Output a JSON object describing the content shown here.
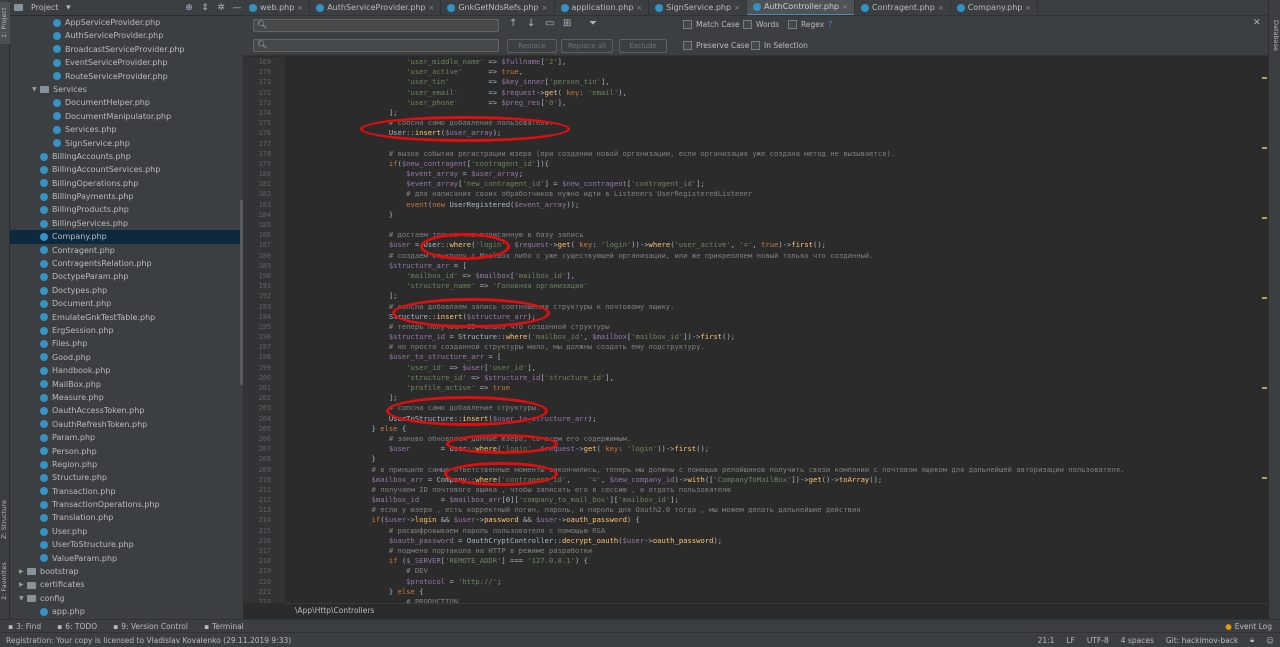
{
  "left_strip": {
    "project_label": "1: Project",
    "structure_label": "Z: Structure",
    "favorites_label": "2: Favorites"
  },
  "right_strip": {
    "database_label": "Database"
  },
  "project_panel": {
    "title": "Project",
    "items": [
      {
        "label": "AppServiceProvider.php",
        "kind": "file",
        "indent": 3
      },
      {
        "label": "AuthServiceProvider.php",
        "kind": "file",
        "indent": 3
      },
      {
        "label": "BroadcastServiceProvider.php",
        "kind": "file",
        "indent": 3
      },
      {
        "label": "EventServiceProvider.php",
        "kind": "file",
        "indent": 3
      },
      {
        "label": "RouteServiceProvider.php",
        "kind": "file",
        "indent": 3
      },
      {
        "label": "Services",
        "kind": "folder-open",
        "indent": 2
      },
      {
        "label": "DocumentHelper.php",
        "kind": "file",
        "indent": 3
      },
      {
        "label": "DocumentManipulator.php",
        "kind": "file",
        "indent": 3
      },
      {
        "label": "Services.php",
        "kind": "file",
        "indent": 3
      },
      {
        "label": "SignService.php",
        "kind": "file",
        "indent": 3
      },
      {
        "label": "BillingAccounts.php",
        "kind": "file",
        "indent": 2
      },
      {
        "label": "BillingAccountServices.php",
        "kind": "file",
        "indent": 2
      },
      {
        "label": "BillingOperations.php",
        "kind": "file",
        "indent": 2
      },
      {
        "label": "BillingPayments.php",
        "kind": "file",
        "indent": 2
      },
      {
        "label": "BillingProducts.php",
        "kind": "file",
        "indent": 2
      },
      {
        "label": "BillingServices.php",
        "kind": "file",
        "indent": 2
      },
      {
        "label": "Company.php",
        "kind": "file",
        "indent": 2,
        "selected": true
      },
      {
        "label": "Contragent.php",
        "kind": "file",
        "indent": 2
      },
      {
        "label": "ContragentsRelation.php",
        "kind": "file",
        "indent": 2
      },
      {
        "label": "DoctypeParam.php",
        "kind": "file",
        "indent": 2
      },
      {
        "label": "Doctypes.php",
        "kind": "file",
        "indent": 2
      },
      {
        "label": "Document.php",
        "kind": "file",
        "indent": 2
      },
      {
        "label": "EmulateGnkTestTable.php",
        "kind": "file",
        "indent": 2
      },
      {
        "label": "ErgSession.php",
        "kind": "file",
        "indent": 2
      },
      {
        "label": "Files.php",
        "kind": "file",
        "indent": 2
      },
      {
        "label": "Good.php",
        "kind": "file",
        "indent": 2
      },
      {
        "label": "Handbook.php",
        "kind": "file",
        "indent": 2
      },
      {
        "label": "MailBox.php",
        "kind": "file",
        "indent": 2
      },
      {
        "label": "Measure.php",
        "kind": "file",
        "indent": 2
      },
      {
        "label": "OauthAccessToken.php",
        "kind": "file",
        "indent": 2
      },
      {
        "label": "OauthRefreshToken.php",
        "kind": "file",
        "indent": 2
      },
      {
        "label": "Param.php",
        "kind": "file",
        "indent": 2
      },
      {
        "label": "Person.php",
        "kind": "file",
        "indent": 2
      },
      {
        "label": "Region.php",
        "kind": "file",
        "indent": 2
      },
      {
        "label": "Structure.php",
        "kind": "file",
        "indent": 2
      },
      {
        "label": "Transaction.php",
        "kind": "file",
        "indent": 2
      },
      {
        "label": "TransactionOperations.php",
        "kind": "file",
        "indent": 2
      },
      {
        "label": "Translation.php",
        "kind": "file",
        "indent": 2
      },
      {
        "label": "User.php",
        "kind": "file",
        "indent": 2
      },
      {
        "label": "UserToStructure.php",
        "kind": "file",
        "indent": 2
      },
      {
        "label": "ValueParam.php",
        "kind": "file",
        "indent": 2
      },
      {
        "label": "bootstrap",
        "kind": "folder",
        "indent": 1
      },
      {
        "label": "certificates",
        "kind": "folder",
        "indent": 1
      },
      {
        "label": "config",
        "kind": "folder-open",
        "indent": 1
      },
      {
        "label": "app.php",
        "kind": "file",
        "indent": 2
      }
    ]
  },
  "tabs": [
    {
      "label": "web.php"
    },
    {
      "label": "AuthServiceProvider.php"
    },
    {
      "label": "GnkGetNdsRefs.php"
    },
    {
      "label": "application.php"
    },
    {
      "label": "SignService.php"
    },
    {
      "label": "AuthController.php",
      "active": true
    },
    {
      "label": "Contragent.php"
    },
    {
      "label": "Company.php"
    }
  ],
  "search": {
    "find_placeholder": "",
    "replace_label": "Replace",
    "replace_all_label": "Replace all",
    "exclude_label": "Exclude",
    "match_case_label": "Match Case",
    "words_label": "Words",
    "regex_label": "Regex",
    "regex_help": "?",
    "preserve_case_label": "Preserve Case",
    "in_selection_label": "In Selection"
  },
  "editor": {
    "first_line": 169,
    "lines": [
      "                            'user_middle_name' => $fullname['2'],",
      "                            'user_active'      => true,",
      "                            'user_tin'         => $key_inner['person_tin'],",
      "                            'user_email'       => $request->get( key: 'email'),",
      "                            'user_phone'       => $preg_res['0'],",
      "                        ];",
      "                        # сопсна само добавление пользователя.",
      "                        User::insert($user_array);",
      "",
      "                        # вызов события регистрации юзера (при создании новой организации, если организация уже создана метод не вызывается).",
      "                        if($new_contragent['contragent_id']){",
      "                            $event_array = $user_array;",
      "                            $event_array['new_contragent_id'] = $new_contragent['contragent_id'];",
      "                            # для написания своих обработчиков нужно идти в Listeners UserRegisteredListener",
      "                            event(new UserRegistered($event_array));",
      "                        }",
      "",
      "                        # достаем только что записанную в базу запись",
      "                        $user = User::where('login', $request->get( key: 'login'))->where('user_active', '=', true)->first();",
      "                        # создаем стукруру с MailBox либо с уже существующей организации, или же прикрепляем новый только что созданный.",
      "                        $structure_arr = [",
      "                            'mailbox_id' => $mailbox['mailbox_id'],",
      "                            'structure_name' => 'Головная организация'",
      "                        ];",
      "                        # сопсна добавляем запись соотношения структуры к почтовому ящику.",
      "                        Structure::insert($structure_arr);",
      "                        # теперь получаем ID только что созданной структуры",
      "                        $structure_id = Structure::where('mailbox_id', $mailbox['mailbox_id'])->first();",
      "                        # но просто созданной структуры мало, мы должны создать ему подструктуру.",
      "                        $user_to_structure_arr = [",
      "                            'user_id' => $user['user_id'],",
      "                            'structure_id' => $structure_id['structure_id'],",
      "                            'profile_active' => true",
      "                        ];",
      "                        # сопсна само добавление структуры.",
      "                        UserToStructure::insert($user_to_structure_arr);",
      "                    } else {",
      "                        # заново обновляем данные юзера, со всем его содержимым.",
      "                        $user       = User::where('login', $request->get( key: 'login'))->first();",
      "                    }",
      "                    # в принципе самые ответственные моменты закончились, теперь мы должны с помощью релайшинов получить связи компании с почтовом ящиком для дальнейшей авторизации пользователя.",
      "                    $mailbox_arr = Company::where('contragent_id',    '=', $new_company_id)->with(['CompanyToMailBox'])->get()->toArray();",
      "                    # получаем ID почтового ящика , чтобы записать его в сессию , и отдать пользователю",
      "                    $mailbox_id     = $mailbox_arr[0]['company_to_mail_box']['mailbox_id'];",
      "                    # если у юзера , есть корректный логин, пароль, и пароль для Oauth2.0 тогда , мы можем делать дальнейшие действия",
      "                    if($user->login && $user->password && $user->oauth_password) {",
      "                        # расшифровываем пароль пользователя с помощью RSA",
      "                        $oauth_password = OauthCryptController::decrypt_oauth($user->oauth_password);",
      "                        # подмена портакола на HTTP в режиме разработки",
      "                        if ($_SERVER['REMOTE_ADDR'] === '127.0.0.1') {",
      "                            # DEV",
      "                            $protocol = 'http://';",
      "                        } else {",
      "                            # PRODUCTION"
    ]
  },
  "breadcrumb": "\\App\\Http\\Controllers",
  "tool_windows": [
    {
      "label": "3: Find"
    },
    {
      "label": "6: TODO"
    },
    {
      "label": "9: Version Control"
    },
    {
      "label": "Terminal"
    }
  ],
  "event_log": "Event Log",
  "status": {
    "message": "Registration: Your copy is licensed to Vladislav Kovalenko (29.11.2019 9:33)",
    "position": "21:1",
    "line_sep": "LF",
    "encoding": "UTF-8",
    "indent": "4 spaces",
    "git": "Git: hackimov-back"
  },
  "colors": {
    "accent": "#4a88c7",
    "annotation": "#e00e0e",
    "keyword": "#cc7832",
    "string": "#6a8759",
    "variable": "#9876aa",
    "comment": "#808080",
    "method": "#ffc66d"
  }
}
